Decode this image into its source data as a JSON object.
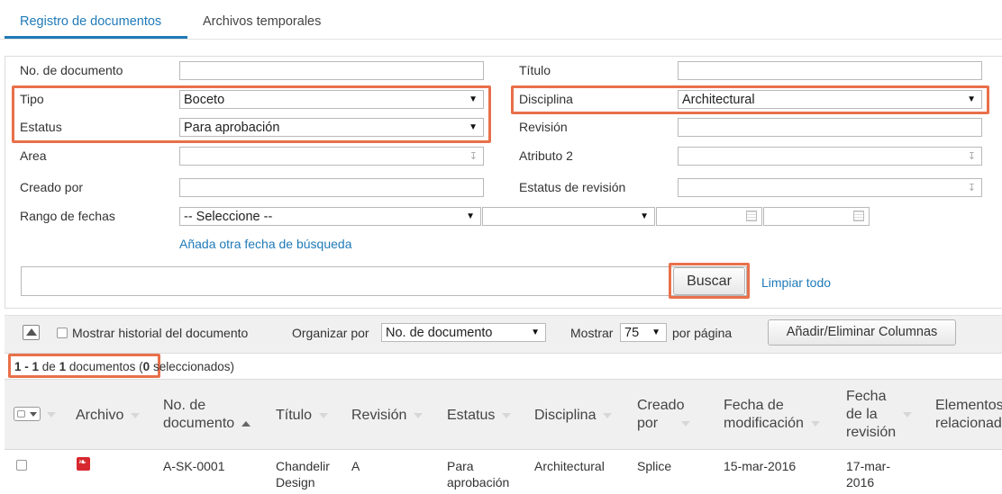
{
  "tabs": [
    {
      "label": "Registro de documentos",
      "active": true
    },
    {
      "label": "Archivos temporales",
      "active": false
    }
  ],
  "search": {
    "doc_number_label": "No. de documento",
    "doc_number_value": "",
    "title_label": "Título",
    "title_value": "",
    "type_label": "Tipo",
    "type_value": "Boceto",
    "discipline_label": "Disciplina",
    "discipline_value": "Architectural",
    "status_label": "Estatus",
    "status_value": "Para aprobación",
    "revision_label": "Revisión",
    "revision_value": "",
    "area_label": "Area",
    "area_value": "",
    "attribute2_label": "Atributo 2",
    "attribute2_value": "",
    "created_by_label": "Creado por",
    "created_by_value": "",
    "revision_status_label": "Estatus de revisión",
    "revision_status_value": "",
    "date_range_label": "Rango de fechas",
    "date_range_value": "-- Seleccione --",
    "add_date_link": "Añada otra fecha de búsqueda",
    "keyword_value": "",
    "search_button": "Buscar",
    "clear_all_link": "Limpiar todo"
  },
  "toolbar": {
    "show_history_label": "Mostrar historial del documento",
    "sort_by_label": "Organizar por",
    "sort_by_value": "No. de documento",
    "show_label": "Mostrar",
    "per_page_value": "75",
    "per_page_label": "por página",
    "columns_button": "Añadir/Eliminar Columnas"
  },
  "results": {
    "range": "1 - 1",
    "of": "de",
    "total": "1",
    "documents_word": "documentos",
    "selected_count": "0",
    "selected_word": "seleccionados)"
  },
  "table": {
    "headers": {
      "file": "Archivo",
      "doc_number_1": "No. de",
      "doc_number_2": "documento",
      "title": "Título",
      "revision": "Revisión",
      "status": "Estatus",
      "discipline": "Disciplina",
      "created_by_1": "Creado",
      "created_by_2": "por",
      "modified_date_1": "Fecha de",
      "modified_date_2": "modificación",
      "revision_date_1": "Fecha",
      "revision_date_2": "de la",
      "revision_date_3": "revisión",
      "related_1": "Elementos",
      "related_2": "relacionados"
    },
    "rows": [
      {
        "doc_number": "A-SK-0001",
        "title_1": "Chandelir",
        "title_2": "Design",
        "revision": "A",
        "status_1": "Para",
        "status_2": "aprobación",
        "discipline": "Architectural",
        "created_by": "Splice",
        "modified_date": "15-mar-2016",
        "revision_date_1": "17-mar-",
        "revision_date_2": "2016"
      }
    ]
  },
  "colors": {
    "accent": "#1f7ab8",
    "highlight": "#e8704a",
    "pdf_icon": "#d7282f"
  }
}
